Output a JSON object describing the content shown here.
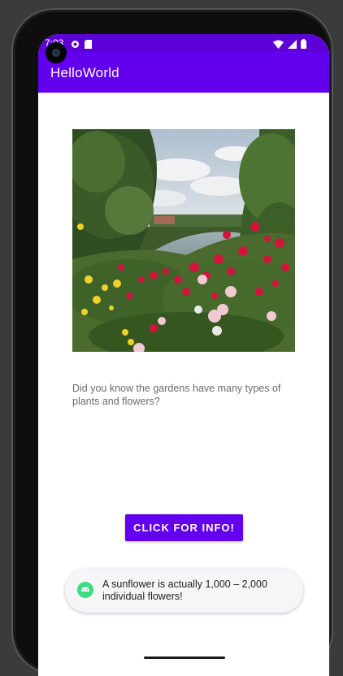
{
  "status_bar": {
    "time": "7:03",
    "background": "#5d00d8",
    "left_icons": [
      "sync-icon",
      "sd-card-icon"
    ],
    "right_icons": [
      "wifi-icon",
      "cellular-signal-icon",
      "battery-icon"
    ]
  },
  "app_bar": {
    "title": "HelloWorld",
    "background": "#6200ee"
  },
  "main": {
    "image_icon": "garden-photo",
    "description": "Did you know the gardens have many types of plants and flowers?",
    "button_label": "CLICK FOR INFO!"
  },
  "toast": {
    "icon": "android-icon",
    "message": "A sunflower is actually 1,000 – 2,000 individual flowers!"
  },
  "colors": {
    "primary": "#6200ee",
    "primary_dark": "#5d00d8",
    "android_green": "#3ddc84"
  }
}
